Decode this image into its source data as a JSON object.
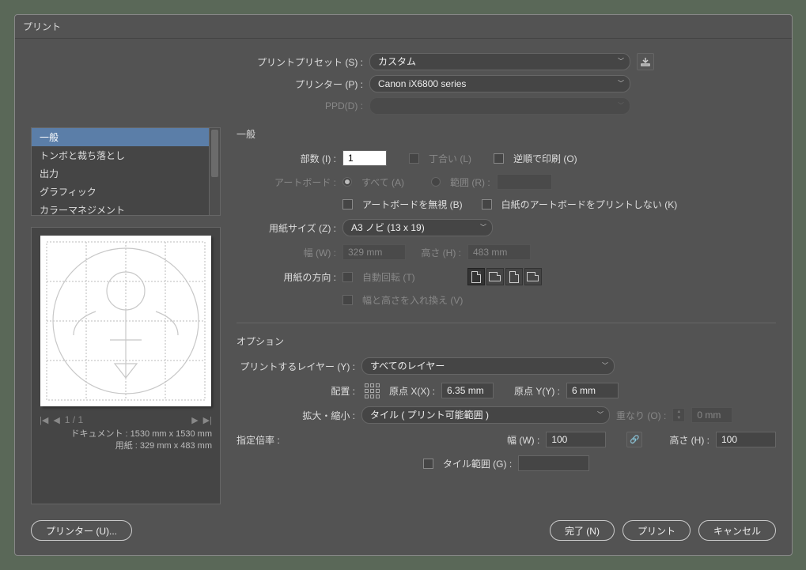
{
  "title": "プリント",
  "top": {
    "preset_label": "プリントプリセット (S) :",
    "preset_value": "カスタム",
    "printer_label": "プリンター (P) :",
    "printer_value": "Canon iX6800 series",
    "ppd_label": "PPD(D) :",
    "ppd_value": ""
  },
  "categories": [
    "一般",
    "トンボと裁ち落とし",
    "出力",
    "グラフィック",
    "カラーマネジメント"
  ],
  "preview": {
    "page": "1 / 1",
    "doc_label": "ドキュメント :",
    "doc_size": "1530 mm x 1530 mm",
    "paper_label": "用紙 :",
    "paper_size": "329 mm x 483 mm"
  },
  "general": {
    "title": "一般",
    "copies_label": "部数 (I) :",
    "copies_value": "1",
    "collate_label": "丁合い (L)",
    "reverse_label": "逆順で印刷 (O)",
    "artboard_label": "アートボード :",
    "artboard_all": "すべて (A)",
    "artboard_range": "範囲 (R) :",
    "ignore_artboard_label": "アートボードを無視 (B)",
    "skip_blank_label": "白紙のアートボードをプリントしない (K)",
    "size_label": "用紙サイズ (Z) :",
    "size_value": "A3 ノビ (13 x 19)",
    "width_label": "幅 (W) :",
    "width_value": "329 mm",
    "height_label": "高さ (H) :",
    "height_value": "483 mm",
    "orient_label": "用紙の方向 :",
    "auto_rotate_label": "自動回転 (T)",
    "swap_label": "幅と高さを入れ換え (V)"
  },
  "options": {
    "title": "オプション",
    "layers_label": "プリントするレイヤー (Y) :",
    "layers_value": "すべてのレイヤー",
    "place_label": "配置 :",
    "origin_x_label": "原点 X(X) :",
    "origin_x_value": "6.35 mm",
    "origin_y_label": "原点 Y(Y) :",
    "origin_y_value": "6 mm",
    "scale_label": "拡大・縮小 :",
    "scale_value": "タイル ( プリント可能範囲 )",
    "overlap_label": "重なり (O) :",
    "overlap_value": "0 mm",
    "ratio_label": "指定倍率 :",
    "width2_label": "幅 (W) :",
    "width2_value": "100",
    "height2_label": "高さ (H) :",
    "height2_value": "100",
    "tilerange_label": "タイル範囲 (G) :",
    "tilerange_value": ""
  },
  "footer": {
    "printer_btn": "プリンター (U)...",
    "done_btn": "完了 (N)",
    "print_btn": "プリント",
    "cancel_btn": "キャンセル"
  }
}
